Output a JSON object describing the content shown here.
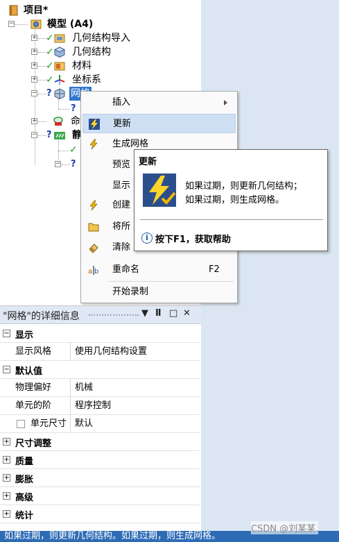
{
  "tree": {
    "root_label": "项目*",
    "model_label": "模型 (A4)",
    "items": [
      {
        "label": "几何结构导入"
      },
      {
        "label": "几何结构"
      },
      {
        "label": "材料"
      },
      {
        "label": "坐标系"
      },
      {
        "label": "网格"
      },
      {
        "label": "命"
      },
      {
        "label": "静"
      }
    ]
  },
  "context_menu": {
    "items": [
      {
        "label": "插入",
        "has_submenu": true
      },
      {
        "label": "更新",
        "highlighted": true
      },
      {
        "label": "生成网格"
      },
      {
        "label": "预览"
      },
      {
        "label": "显示"
      },
      {
        "label": "创建"
      },
      {
        "label": "将所"
      },
      {
        "label": "清除"
      },
      {
        "label": "重命名",
        "shortcut": "F2"
      },
      {
        "label": "开始录制"
      }
    ]
  },
  "tooltip": {
    "title": "更新",
    "line1": "如果过期，则更新几何结构；",
    "line2": "如果过期，则生成网格。",
    "help": "按下F1，获取帮助"
  },
  "details": {
    "title": "\"网格\"的详细信息",
    "buttons": [
      "▼",
      "ᵠ",
      "□",
      "✕"
    ],
    "rows": [
      {
        "type": "category",
        "label": "显示",
        "expander": "−"
      },
      {
        "type": "prop",
        "name": "显示风格",
        "value": "使用几何结构设置"
      },
      {
        "type": "category",
        "label": "默认值",
        "expander": "−"
      },
      {
        "type": "prop",
        "name": "物理偏好",
        "value": "机械"
      },
      {
        "type": "prop",
        "name": "单元的阶",
        "value": "程序控制"
      },
      {
        "type": "checkprop",
        "name": "单元尺寸",
        "value": "默认"
      },
      {
        "type": "category",
        "label": "尺寸调整",
        "expander": "+"
      },
      {
        "type": "category",
        "label": "质量",
        "expander": "+"
      },
      {
        "type": "category",
        "label": "膨胀",
        "expander": "+"
      },
      {
        "type": "category",
        "label": "高级",
        "expander": "+"
      },
      {
        "type": "category",
        "label": "统计",
        "expander": "+"
      }
    ]
  },
  "status_bar": {
    "text": "如果过期，则更新几何结构。如果过期，则生成网格。"
  },
  "watermark": "CSDN @刘某某."
}
